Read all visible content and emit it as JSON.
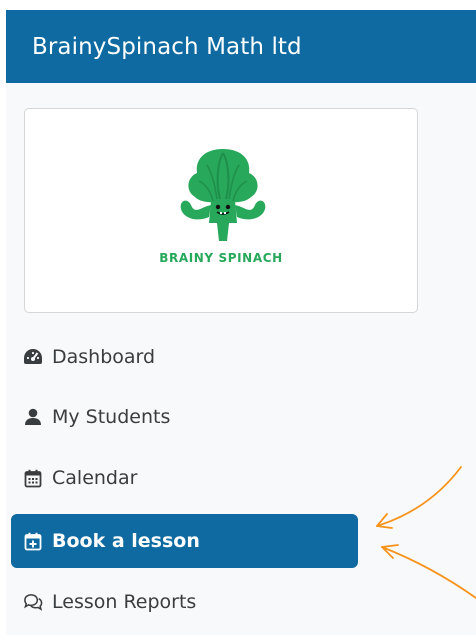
{
  "brand": {
    "title": "BrainySpinach Math ltd",
    "logo_text": "BRAINY SPINACH"
  },
  "nav": {
    "items": [
      {
        "label": "Dashboard",
        "icon": "tachometer-icon"
      },
      {
        "label": "My Students",
        "icon": "user-icon"
      },
      {
        "label": "Calendar",
        "icon": "calendar-icon"
      },
      {
        "label": "Book a lesson",
        "icon": "calendar-plus-icon",
        "active": true
      },
      {
        "label": "Lesson Reports",
        "icon": "comments-icon"
      }
    ]
  },
  "colors": {
    "primary": "#0e6aa0",
    "sidebar_bg": "#f8f9fa",
    "logo_green": "#27a85a",
    "annotation_arrow": "#f7941d"
  }
}
